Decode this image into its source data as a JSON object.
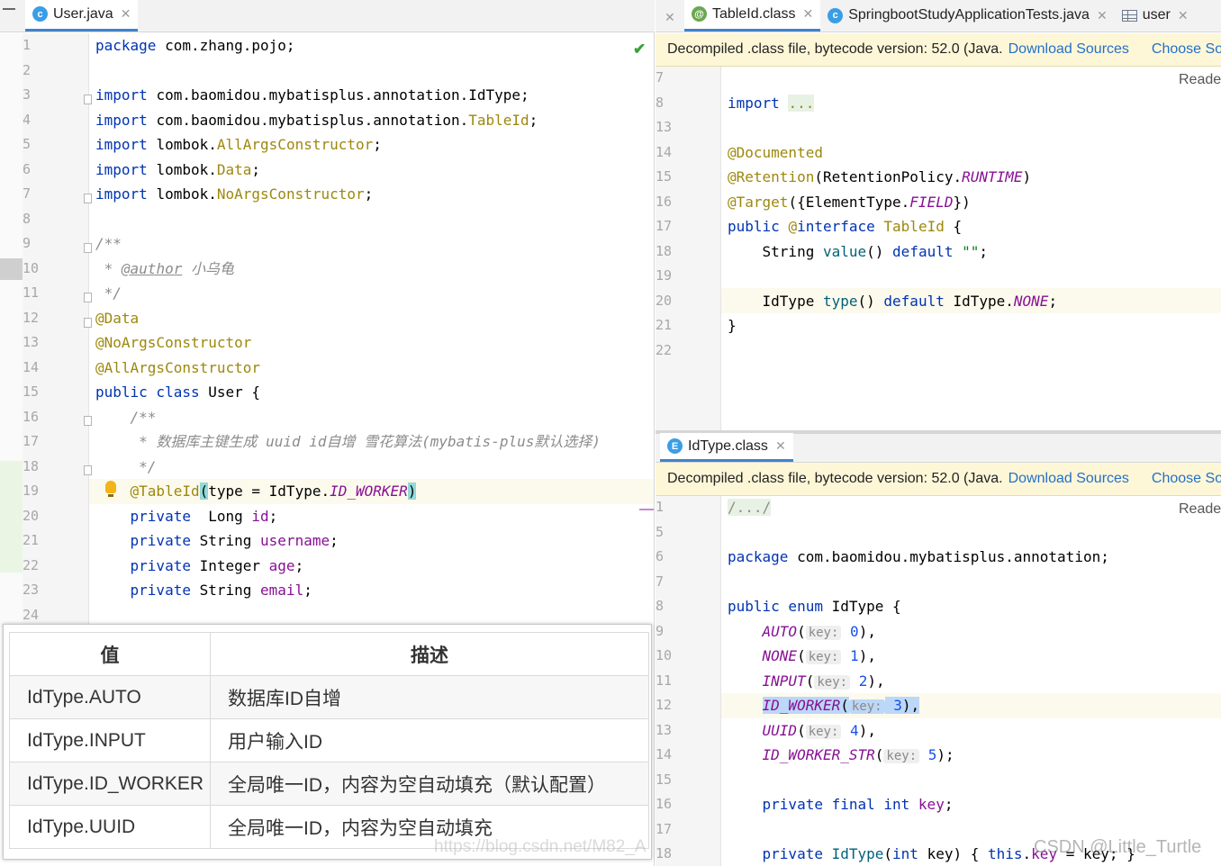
{
  "left_editor": {
    "tab": {
      "label": "User.java",
      "icon": "class-c-icon"
    },
    "lines": [
      {
        "n": "1",
        "segs": [
          [
            "kw",
            "package "
          ],
          [
            "ty",
            "com.zhang.pojo;"
          ]
        ]
      },
      {
        "n": "2",
        "segs": []
      },
      {
        "n": "3",
        "segs": [
          [
            "kw",
            "import "
          ],
          [
            "ty",
            "com.baomidou.mybatisplus.annotation.IdType;"
          ]
        ]
      },
      {
        "n": "4",
        "segs": [
          [
            "kw",
            "import "
          ],
          [
            "ty",
            "com.baomidou.mybatisplus.annotation."
          ],
          [
            "imp",
            "TableId"
          ],
          [
            "ty",
            ";"
          ]
        ]
      },
      {
        "n": "5",
        "segs": [
          [
            "kw",
            "import "
          ],
          [
            "ty",
            "lombok."
          ],
          [
            "imp",
            "AllArgsConstructor"
          ],
          [
            "ty",
            ";"
          ]
        ]
      },
      {
        "n": "6",
        "segs": [
          [
            "kw",
            "import "
          ],
          [
            "ty",
            "lombok."
          ],
          [
            "imp",
            "Data"
          ],
          [
            "ty",
            ";"
          ]
        ]
      },
      {
        "n": "7",
        "segs": [
          [
            "kw",
            "import "
          ],
          [
            "ty",
            "lombok."
          ],
          [
            "imp",
            "NoArgsConstructor"
          ],
          [
            "ty",
            ";"
          ]
        ]
      },
      {
        "n": "8",
        "segs": []
      },
      {
        "n": "9",
        "segs": [
          [
            "cm",
            "/**"
          ]
        ]
      },
      {
        "n": "10",
        "segs": [
          [
            "cm",
            " * "
          ],
          [
            "cmtag",
            "@author"
          ],
          [
            "cm",
            " 小乌龟"
          ]
        ]
      },
      {
        "n": "11",
        "segs": [
          [
            "cm",
            " */"
          ]
        ]
      },
      {
        "n": "12",
        "segs": [
          [
            "ann",
            "@Data"
          ]
        ]
      },
      {
        "n": "13",
        "segs": [
          [
            "ann",
            "@NoArgsConstructor"
          ]
        ]
      },
      {
        "n": "14",
        "segs": [
          [
            "ann",
            "@AllArgsConstructor"
          ]
        ]
      },
      {
        "n": "15",
        "segs": [
          [
            "kw",
            "public class "
          ],
          [
            "ty",
            "User {"
          ]
        ]
      },
      {
        "n": "16",
        "segs": [
          [
            "cm",
            "    /**"
          ]
        ]
      },
      {
        "n": "17",
        "segs": [
          [
            "cm",
            "     * 数据库主键生成 uuid id自增 雪花算法(mybatis-plus默认选择)"
          ]
        ]
      },
      {
        "n": "18",
        "segs": [
          [
            "cm",
            "     */"
          ]
        ]
      },
      {
        "n": "19",
        "segs": [
          [
            "ann",
            "    @TableId"
          ],
          [
            "brk",
            "("
          ],
          [
            "ty",
            "type = IdType."
          ],
          [
            "enm",
            "ID_WORKER"
          ],
          [
            "brk",
            ")"
          ]
        ]
      },
      {
        "n": "20",
        "segs": [
          [
            "kw",
            "    private  "
          ],
          [
            "ty",
            "Long "
          ],
          [
            "fld",
            "id"
          ],
          [
            "ty",
            ";"
          ]
        ]
      },
      {
        "n": "21",
        "segs": [
          [
            "kw",
            "    private "
          ],
          [
            "ty",
            "String "
          ],
          [
            "fld",
            "username"
          ],
          [
            "ty",
            ";"
          ]
        ]
      },
      {
        "n": "22",
        "segs": [
          [
            "kw",
            "    private "
          ],
          [
            "ty",
            "Integer "
          ],
          [
            "fld",
            "age"
          ],
          [
            "ty",
            ";"
          ]
        ]
      },
      {
        "n": "23",
        "segs": [
          [
            "kw",
            "    private "
          ],
          [
            "ty",
            "String "
          ],
          [
            "fld",
            "email"
          ],
          [
            "ty",
            ";"
          ]
        ]
      },
      {
        "n": "24",
        "segs": []
      }
    ]
  },
  "top_right_editor": {
    "tabs": [
      {
        "label": "TableId.class",
        "icon": "annotation-icon",
        "active": true
      },
      {
        "label": "SpringbootStudyApplicationTests.java",
        "icon": "test-class-icon",
        "active": false
      },
      {
        "label": "user",
        "icon": "table-icon",
        "active": false
      }
    ],
    "banner": {
      "text": "Decompiled .class file, bytecode version: 52.0 (Java.",
      "link1": "Download Sources",
      "link2": "Choose So"
    },
    "reader_label": "Reade",
    "lines": [
      {
        "n": "7",
        "segs": []
      },
      {
        "n": "8",
        "segs": [
          [
            "kw",
            "import "
          ],
          [
            "fold",
            "..."
          ]
        ]
      },
      {
        "n": "13",
        "segs": []
      },
      {
        "n": "14",
        "segs": [
          [
            "ann",
            "@Documented"
          ]
        ]
      },
      {
        "n": "15",
        "segs": [
          [
            "ann",
            "@Retention"
          ],
          [
            "ty",
            "(RetentionPolicy."
          ],
          [
            "enm",
            "RUNTIME"
          ],
          [
            "ty",
            ")"
          ]
        ]
      },
      {
        "n": "16",
        "segs": [
          [
            "ann",
            "@Target"
          ],
          [
            "ty",
            "({ElementType."
          ],
          [
            "enm",
            "FIELD"
          ],
          [
            "ty",
            "})"
          ]
        ]
      },
      {
        "n": "17",
        "segs": [
          [
            "kw",
            "public "
          ],
          [
            "ann",
            "@"
          ],
          [
            "kw",
            "interface "
          ],
          [
            "imp",
            "TableId"
          ],
          [
            "ty",
            " {"
          ]
        ]
      },
      {
        "n": "18",
        "segs": [
          [
            "ty",
            "    String "
          ],
          [
            "mth",
            "value"
          ],
          [
            "ty",
            "() "
          ],
          [
            "kw",
            "default "
          ],
          [
            "str",
            "\"\""
          ],
          [
            "ty",
            ";"
          ]
        ]
      },
      {
        "n": "19",
        "segs": []
      },
      {
        "n": "20",
        "segs": [
          [
            "ty",
            "    IdType "
          ],
          [
            "mth",
            "type"
          ],
          [
            "ty",
            "() "
          ],
          [
            "kw",
            "default "
          ],
          [
            "ty",
            "IdType."
          ],
          [
            "enm",
            "NONE"
          ],
          [
            "ty",
            ";"
          ]
        ]
      },
      {
        "n": "21",
        "segs": [
          [
            "ty",
            "}"
          ]
        ]
      },
      {
        "n": "22",
        "segs": []
      }
    ]
  },
  "bottom_right_editor": {
    "tab": {
      "label": "IdType.class",
      "icon": "enum-e-icon"
    },
    "banner": {
      "text": "Decompiled .class file, bytecode version: 52.0 (Java.",
      "link1": "Download Sources",
      "link2": "Choose So"
    },
    "reader_label": "Reade",
    "lines": [
      {
        "n": "1",
        "segs": [
          [
            "foldc",
            "/.../"
          ]
        ]
      },
      {
        "n": "5",
        "segs": []
      },
      {
        "n": "6",
        "segs": [
          [
            "kw",
            "package "
          ],
          [
            "ty",
            "com.baomidou.mybatisplus.annotation;"
          ]
        ]
      },
      {
        "n": "7",
        "segs": []
      },
      {
        "n": "8",
        "segs": [
          [
            "kw",
            "public enum "
          ],
          [
            "ty",
            "IdType {"
          ]
        ]
      },
      {
        "n": "9",
        "segs": [
          [
            "enm",
            "    AUTO"
          ],
          [
            "ty",
            "("
          ],
          [
            "hint",
            "key:"
          ],
          [
            "num",
            " 0"
          ],
          [
            "ty",
            "),"
          ]
        ]
      },
      {
        "n": "10",
        "segs": [
          [
            "enm",
            "    NONE"
          ],
          [
            "ty",
            "("
          ],
          [
            "hint",
            "key:"
          ],
          [
            "num",
            " 1"
          ],
          [
            "ty",
            "),"
          ]
        ]
      },
      {
        "n": "11",
        "segs": [
          [
            "enm",
            "    INPUT"
          ],
          [
            "ty",
            "("
          ],
          [
            "hint",
            "key:"
          ],
          [
            "num",
            " 2"
          ],
          [
            "ty",
            "),"
          ]
        ]
      },
      {
        "n": "12",
        "segs": [
          [
            "enmsel",
            "    ID_WORKER"
          ],
          [
            "tysel",
            "("
          ],
          [
            "hintsel",
            "key:"
          ],
          [
            "numsel",
            " 3"
          ],
          [
            "tysel",
            "),"
          ]
        ]
      },
      {
        "n": "13",
        "segs": [
          [
            "enm",
            "    UUID"
          ],
          [
            "ty",
            "("
          ],
          [
            "hint",
            "key:"
          ],
          [
            "num",
            " 4"
          ],
          [
            "ty",
            "),"
          ]
        ]
      },
      {
        "n": "14",
        "segs": [
          [
            "enm",
            "    ID_WORKER_STR"
          ],
          [
            "ty",
            "("
          ],
          [
            "hint",
            "key:"
          ],
          [
            "num",
            " 5"
          ],
          [
            "ty",
            ");"
          ]
        ]
      },
      {
        "n": "15",
        "segs": []
      },
      {
        "n": "16",
        "segs": [
          [
            "kw",
            "    private final int "
          ],
          [
            "fld",
            "key"
          ],
          [
            "ty",
            ";"
          ]
        ]
      },
      {
        "n": "17",
        "segs": []
      },
      {
        "n": "18",
        "segs": [
          [
            "kw",
            "    private "
          ],
          [
            "mth",
            "IdType"
          ],
          [
            "ty",
            "("
          ],
          [
            "kw",
            "int "
          ],
          [
            "ty",
            "key) { "
          ],
          [
            "kw",
            "this"
          ],
          [
            "ty",
            "."
          ],
          [
            "fld",
            "key"
          ],
          [
            "ty",
            " = key; }"
          ]
        ]
      }
    ]
  },
  "id_table": {
    "headers": [
      "值",
      "描述"
    ],
    "rows": [
      [
        "IdType.AUTO",
        "数据库ID自增"
      ],
      [
        "IdType.INPUT",
        "用户输入ID"
      ],
      [
        "IdType.ID_WORKER",
        "全局唯一ID，内容为空自动填充（默认配置）"
      ],
      [
        "IdType.UUID",
        "全局唯一ID，内容为空自动填充"
      ]
    ],
    "watermark": "https://blog.csdn.net/M82_A"
  },
  "watermark": "CSDN @Little_Turtle",
  "colors": {
    "keyword": "#0033b3",
    "annotation": "#9e880d",
    "comment": "#8c8c8c",
    "field": "#871094",
    "banner_bg": "#fdf7d8",
    "link": "#2470c8",
    "active_tab": "#4083c9"
  }
}
